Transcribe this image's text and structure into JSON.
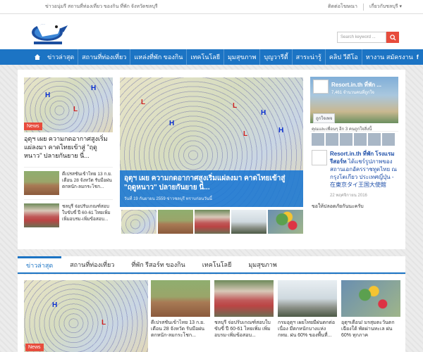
{
  "topbar": {
    "tagline": "ข่าวอนุ่มรี สถานที่ท่องเที่ยว ของกิน ที่พัก จังหวัดชลบุรี",
    "contact": "ติดต่อโฆษณา",
    "about": "เกี่ยวกับชลบุรี"
  },
  "header": {
    "search_placeholder": "Search keyword ..."
  },
  "nav": {
    "items": [
      "ข่าวล่าสุด",
      "สถานที่ท่องเที่ยว",
      "แหล่งที่พัก ของกิน",
      "เทคโนโลยี",
      "มุมสุขภาพ",
      "บุญวารีตี้",
      "สาระน่ารู้",
      "คลิป วีดีโอ",
      "หางาน สมัครงาน"
    ],
    "socials": [
      "f",
      "g",
      "t"
    ]
  },
  "featured": {
    "left_badge": "News",
    "left_title": "อุตุฯ เผย ความกดอากาศสูงเริ่มแผ่ลงมา คาดไทยเข้าสู่ \"ฤดูหนาว\" ปลายกันยาย นี่...",
    "small1": "ดีเปรสชันเข้าไทย 13 ก.ย. เตือน 28 จังหวัด รับมือฝนตกหนัก-ลมกระโชก...",
    "small2": "ชลบุรี จ่อปรับเกณฑ์สอบใบขับขี่ ปี 60-61 ไทยเพิ่ม เพิ่มอบรม-เพิ่มข้อสอบ...",
    "main_title": "อุตุฯ เผย ความกดอากาศสูงเริ่มแผ่ลงมา คาดไทยเข้าสู่ \"ฤดูหนาว\" ปลายกันยาย นี่...",
    "main_meta": "วันที่ 19 กันยายน 2559 ข่าวชลบุรี ทราบก่อนวันนี้"
  },
  "facebook": {
    "page_name": "Resort.in.th ที่พัก ...",
    "likes": "7,461 จำนวนคนที่ถูกใจ",
    "like_button": "ถูกใจเพจ",
    "friends_text": "คุณและเพื่อนๆ อีก 3 คนถูกใจสิ่งนี้",
    "post_title": "Resort.in.th ที่พัก โรงแรม รีสอร์ท",
    "post_text": "ได้แชร์รูปภาพของ สถานเอกอัครราชทูตไทย ณ กรุงโตเกียว ประเทศญี่ปุ่น - 在東京タイ王国大使館",
    "post_date": "22 พฤศจิกายน 2016",
    "ask": "ขอให้ปลอดภัยกันนะครับ"
  },
  "tabs": [
    "ข่าวล่าสุด",
    "สถานที่ท่องเที่ยว",
    "ที่พัก รีสอร์ท ของกิน",
    "เทคโนโลยี",
    "มุมสุขภาพ"
  ],
  "grid": {
    "badge": "News",
    "captions": [
      "ดีเปรสชันเข้าไทย 13 ก.ย. เตือน 28 จังหวัด รับมือฝนตกหนัก-ลมกระโชก...",
      "ชลบุรี จ่อปรับเกณฑ์สอบใบขับขี่ ปี 60-61 ไทยเพิ่ม เพิ่มอบรม-เพิ่มข้อสอบ...",
      "กรมอุตุฯ เผยไทยมีฝนตกต่อเนื่อง มีตกหนักบางแห่ง กทม. ฝน 60% ของพื้นที่...",
      "อุตุฯเตือน! มรสุมตะวันตกเฉียงใต้ พัดผ่านทะเล ฝน 60% ทุกภาค"
    ]
  }
}
